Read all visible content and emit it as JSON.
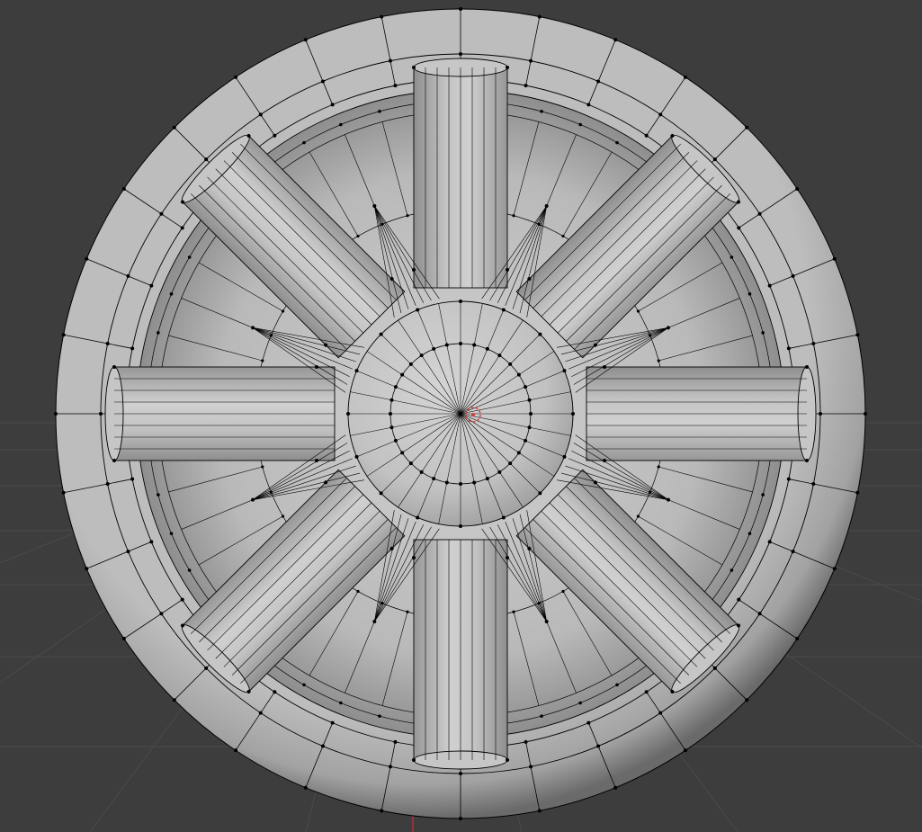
{
  "viewport": {
    "background_color": "#3d3d3d",
    "grid_color": "#4a4a4a",
    "x_axis_color": "#b0303a"
  },
  "mesh": {
    "object": "wheel",
    "spoke_count": 8,
    "edit_mode": "vertex",
    "wire_color": "#000000",
    "vertex_color": "#000000",
    "surface_color": "#b4b4b4"
  },
  "origin_marker": {
    "icon": "3d-cursor-icon",
    "color": "#d04040"
  }
}
